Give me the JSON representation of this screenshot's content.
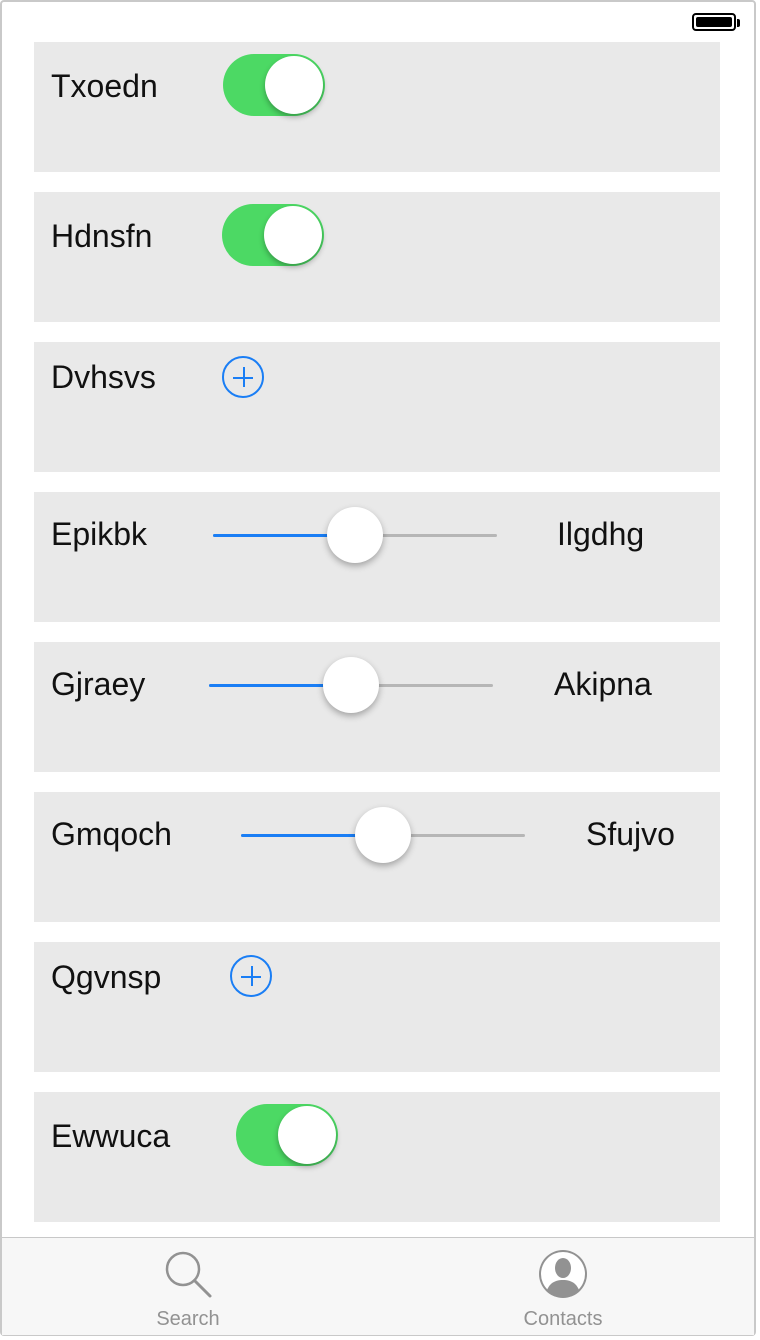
{
  "status": {
    "battery": "full"
  },
  "rows": [
    {
      "type": "toggle",
      "label": "Txoedn",
      "on": true
    },
    {
      "type": "toggle",
      "label": "Hdnsfn",
      "on": true
    },
    {
      "type": "add",
      "label": "Dvhsvs",
      "icon": "plus-circle-icon"
    },
    {
      "type": "slider",
      "label": "Epikbk",
      "value_label": "Ilgdhg",
      "fraction": 0.5
    },
    {
      "type": "slider",
      "label": "Gjraey",
      "value_label": "Akipna",
      "fraction": 0.5
    },
    {
      "type": "slider",
      "label": "Gmqoch",
      "value_label": "Sfujvo",
      "fraction": 0.5
    },
    {
      "type": "add",
      "label": "Qgvnsp",
      "icon": "plus-circle-icon"
    },
    {
      "type": "toggle",
      "label": "Ewwuca",
      "on": true
    }
  ],
  "tabs": [
    {
      "label": "Search",
      "icon": "search-icon"
    },
    {
      "label": "Contacts",
      "icon": "contact-icon"
    }
  ],
  "colors": {
    "accent": "#1a7ef5",
    "toggle_on": "#4cd964",
    "row_bg": "#e9e9e9"
  }
}
